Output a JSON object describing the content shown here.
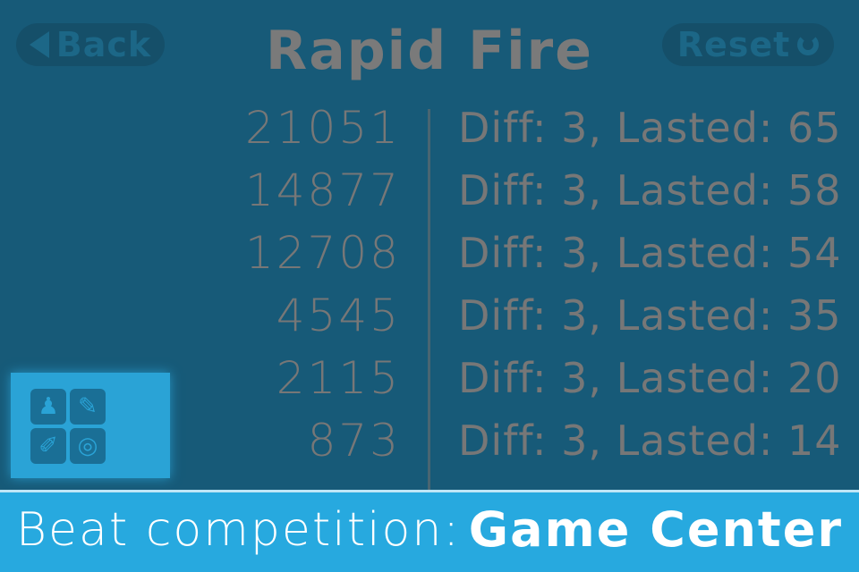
{
  "header": {
    "title": "Rapid Fire",
    "back_label": "Back",
    "reset_label": "Reset"
  },
  "scores": [
    {
      "score": "21051",
      "detail": "Diff: 3, Lasted: 65"
    },
    {
      "score": "14877",
      "detail": "Diff: 3, Lasted: 58"
    },
    {
      "score": "12708",
      "detail": "Diff: 3, Lasted: 54"
    },
    {
      "score": "4545",
      "detail": "Diff: 3, Lasted: 35"
    },
    {
      "score": "2115",
      "detail": "Diff: 3, Lasted: 20"
    },
    {
      "score": "873",
      "detail": "Diff: 3, Lasted: 14"
    }
  ],
  "overlay": {
    "icons": [
      "pawn-icon",
      "pencil-icon",
      "tag-icon",
      "target-icon"
    ]
  },
  "banner": {
    "left_text": "Beat competition:",
    "right_text": "Game Center"
  },
  "colors": {
    "background": "#175a78",
    "text_dim": "#777777",
    "banner": "#27a9df",
    "overlay": "#2aa3d6"
  }
}
